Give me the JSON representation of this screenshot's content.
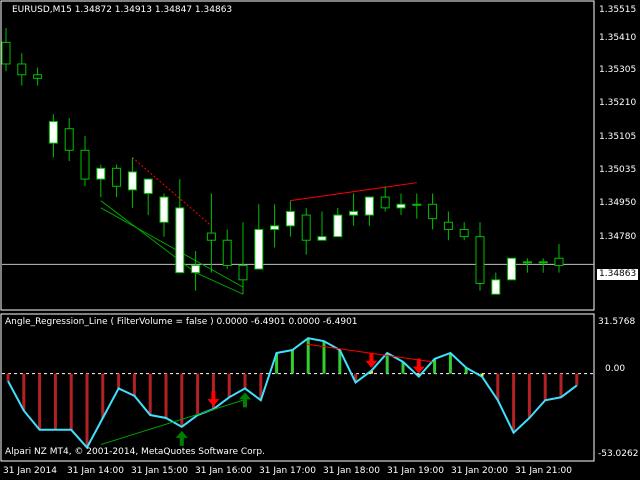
{
  "header": {
    "title": "EURUSD,M15  1.34872 1.34913 1.34847 1.34863"
  },
  "indicator": {
    "title": "Angle_Regression_Line ( FilterVolume = false ) 0.0000 -6.4901 0.0000 -6.4901",
    "axis": [
      "31.5768",
      "0.00",
      "-53.0262"
    ],
    "copyright": "Alpari NZ MT4, © 2001-2014, MetaQuotes Software Corp."
  },
  "price_axis": [
    "1.35515",
    "1.35410",
    "1.35305",
    "1.35210",
    "1.35105",
    "1.35035",
    "1.34950",
    "1.34780"
  ],
  "current_price": "1.34863",
  "time_axis": [
    "31 Jan 2014",
    "31 Jan 14:00",
    "31 Jan 15:00",
    "31 Jan 16:00",
    "31 Jan 17:00",
    "31 Jan 18:00",
    "31 Jan 19:00",
    "31 Jan 20:00",
    "31 Jan 21:00"
  ],
  "colors": {
    "bull": "#ffffff",
    "bear": "#000000",
    "wick": "#00c000",
    "osc_line": "#40e0ff",
    "bar_red": "#b22222",
    "bar_green": "#32cd32",
    "bar_yellow": "#ffff00",
    "arrow_red": "#ff0000",
    "arrow_green": "#008000"
  },
  "chart_data": {
    "type": "candlestick",
    "price_range": [
      1.3475,
      1.3557
    ],
    "candles": [
      [
        1.3548,
        1.3552,
        1.354,
        1.3542
      ],
      [
        1.3542,
        1.3545,
        1.3536,
        1.3539
      ],
      [
        1.3539,
        1.3541,
        1.3536,
        1.3538
      ],
      [
        1.352,
        1.3528,
        1.3516,
        1.3526
      ],
      [
        1.3524,
        1.3527,
        1.3515,
        1.3518
      ],
      [
        1.3518,
        1.3522,
        1.3508,
        1.351
      ],
      [
        1.351,
        1.3514,
        1.3505,
        1.3513
      ],
      [
        1.3513,
        1.3514,
        1.3505,
        1.3508
      ],
      [
        1.3507,
        1.3516,
        1.3502,
        1.3512
      ],
      [
        1.3506,
        1.351,
        1.35,
        1.351
      ],
      [
        1.3498,
        1.3506,
        1.3494,
        1.3505
      ],
      [
        1.3484,
        1.351,
        1.3484,
        1.3502
      ],
      [
        1.3484,
        1.349,
        1.3479,
        1.3486
      ],
      [
        1.3495,
        1.3506,
        1.3484,
        1.3493
      ],
      [
        1.3493,
        1.3496,
        1.3485,
        1.3486
      ],
      [
        1.3486,
        1.3498,
        1.3478,
        1.3482
      ],
      [
        1.3485,
        1.3503,
        1.3485,
        1.3496
      ],
      [
        1.3496,
        1.3503,
        1.3491,
        1.3497
      ],
      [
        1.3497,
        1.3504,
        1.3494,
        1.3501
      ],
      [
        1.35,
        1.3502,
        1.3489,
        1.3493
      ],
      [
        1.3493,
        1.3501,
        1.3493,
        1.3494
      ],
      [
        1.3494,
        1.3502,
        1.3494,
        1.35
      ],
      [
        1.35,
        1.3506,
        1.3497,
        1.3501
      ],
      [
        1.35,
        1.3505,
        1.3497,
        1.3505
      ],
      [
        1.3505,
        1.3508,
        1.3501,
        1.3502
      ],
      [
        1.3502,
        1.3506,
        1.35,
        1.3503
      ],
      [
        1.3503,
        1.3506,
        1.3499,
        1.3503
      ],
      [
        1.3503,
        1.3506,
        1.3496,
        1.3499
      ],
      [
        1.3498,
        1.3501,
        1.3493,
        1.3496
      ],
      [
        1.3496,
        1.3498,
        1.3493,
        1.3494
      ],
      [
        1.3494,
        1.3498,
        1.3479,
        1.3481
      ],
      [
        1.3478,
        1.3484,
        1.3478,
        1.3482
      ],
      [
        1.3482,
        1.3488,
        1.3482,
        1.3488
      ],
      [
        1.3487,
        1.3488,
        1.3484,
        1.3487
      ],
      [
        1.3487,
        1.3488,
        1.3484,
        1.3487
      ],
      [
        1.3488,
        1.3492,
        1.3484,
        1.3486
      ]
    ],
    "oscillator": {
      "range": [
        -53.0262,
        31.5768
      ],
      "values": [
        -5,
        -25,
        -38,
        -38,
        -38,
        -50,
        -30,
        -10,
        -15,
        -28,
        -30,
        -36,
        -28,
        -24,
        -16,
        -10,
        -18,
        14,
        16,
        24,
        22,
        16,
        -6,
        2,
        14,
        8,
        -2,
        10,
        14,
        4,
        -2,
        -18,
        -40,
        -30,
        -18,
        -16,
        -8
      ],
      "green_trend": [
        [
          6,
          -48
        ],
        [
          15,
          -18
        ]
      ],
      "red_trend": [
        [
          19,
          20
        ],
        [
          27,
          8
        ]
      ],
      "red_arrows": [
        13,
        23,
        26
      ],
      "green_arrows": [
        11,
        15
      ]
    }
  }
}
